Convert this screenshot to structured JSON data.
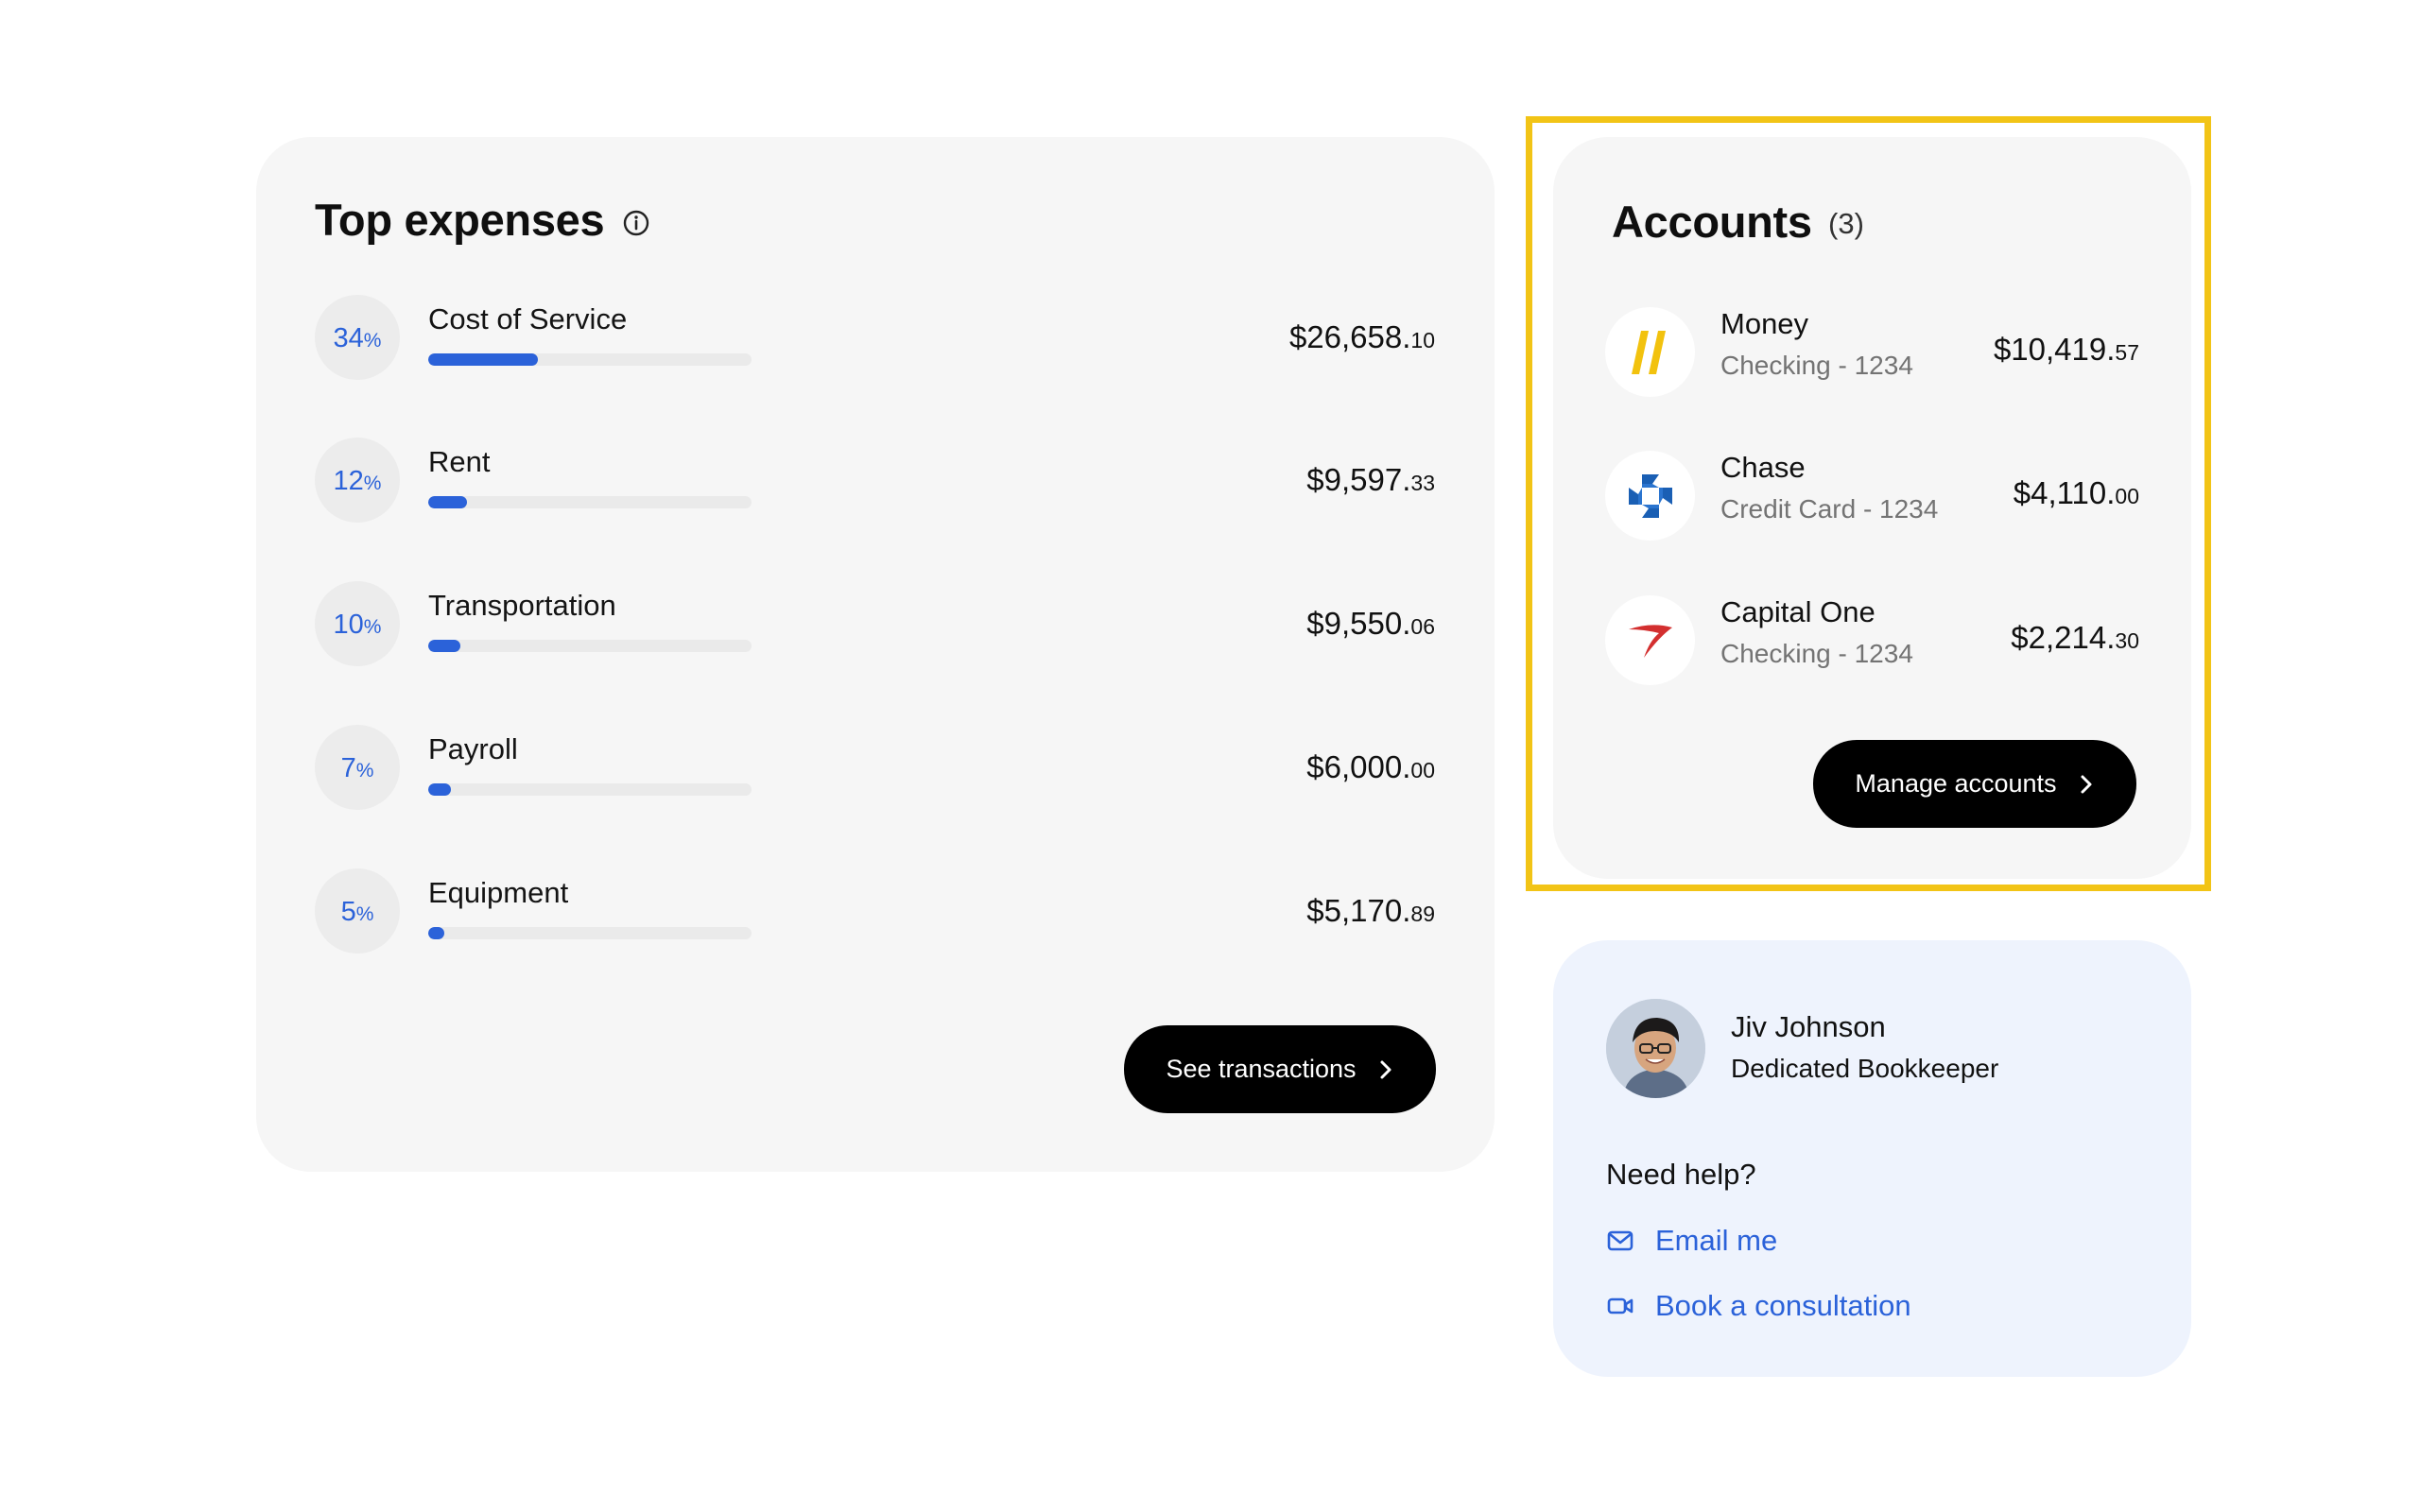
{
  "expenses": {
    "title": "Top expenses",
    "items": [
      {
        "pct": "34",
        "pct_value": 34,
        "label": "Cost of Service",
        "amount_main": "$26,658.",
        "amount_cents": "10"
      },
      {
        "pct": "12",
        "pct_value": 12,
        "label": "Rent",
        "amount_main": "$9,597.",
        "amount_cents": "33"
      },
      {
        "pct": "10",
        "pct_value": 10,
        "label": "Transportation",
        "amount_main": "$9,550.",
        "amount_cents": "06"
      },
      {
        "pct": "7",
        "pct_value": 7,
        "label": "Payroll",
        "amount_main": "$6,000.",
        "amount_cents": "00"
      },
      {
        "pct": "5",
        "pct_value": 5,
        "label": "Equipment",
        "amount_main": "$5,170.",
        "amount_cents": "89"
      }
    ],
    "pct_sign": "%",
    "bar_scale_max": 100,
    "see_transactions_label": "See transactions"
  },
  "accounts": {
    "title": "Accounts",
    "count": "(3)",
    "items": [
      {
        "name": "Money",
        "sub": "Checking - 1234",
        "amount_main": "$10,419.",
        "amount_cents": "57",
        "icon": "money-logo-icon"
      },
      {
        "name": "Chase",
        "sub": "Credit Card - 1234",
        "amount_main": "$4,110.",
        "amount_cents": "00",
        "icon": "chase-logo-icon"
      },
      {
        "name": "Capital One",
        "sub": "Checking - 1234",
        "amount_main": "$2,214.",
        "amount_cents": "30",
        "icon": "capital-one-logo-icon"
      }
    ],
    "manage_label": "Manage accounts"
  },
  "help": {
    "person_name": "Jiv Johnson",
    "person_role": "Dedicated Bookkeeper",
    "heading": "Need help?",
    "email_label": "Email me",
    "consult_label": "Book a consultation"
  },
  "colors": {
    "accent_blue": "#2b62d9",
    "highlight_yellow": "#f2c416",
    "card_bg": "#f6f6f6",
    "help_bg": "#eef3fd",
    "button_bg": "#000000"
  }
}
